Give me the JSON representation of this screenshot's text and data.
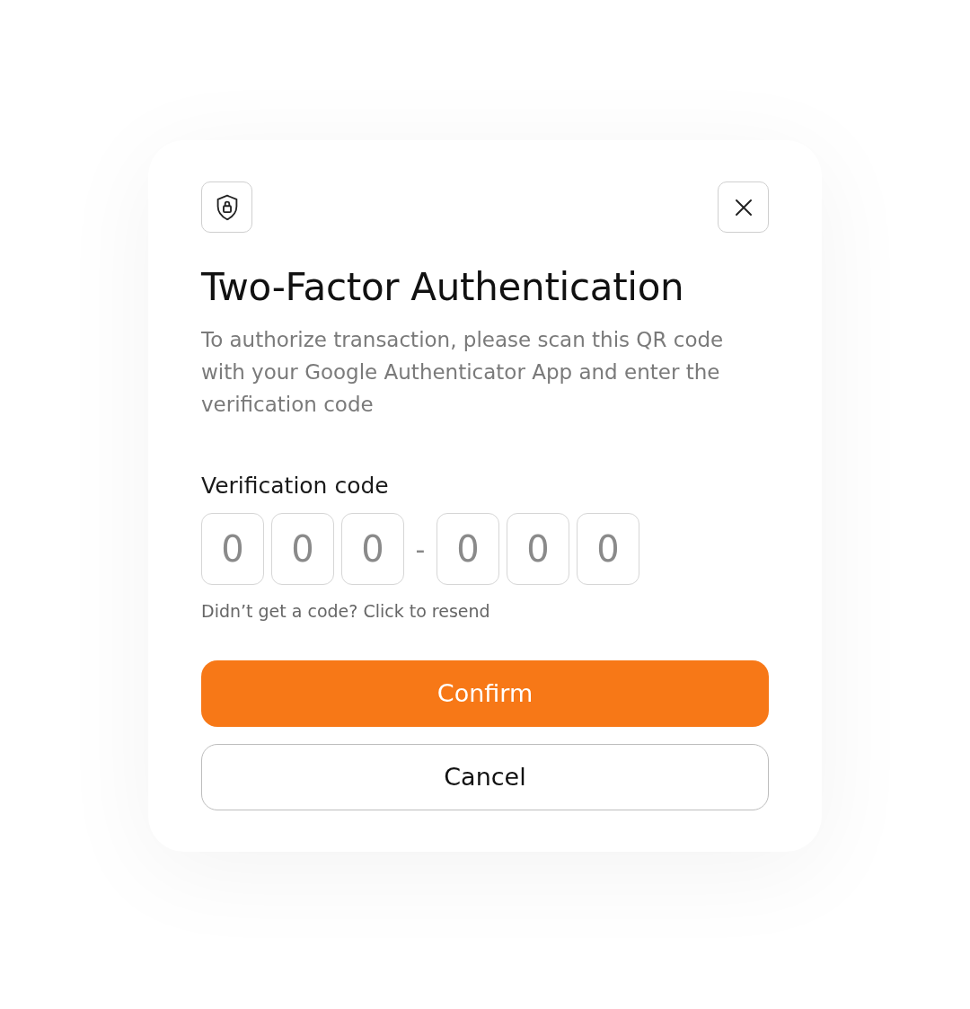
{
  "dialog": {
    "title": "Two-Factor Authentication",
    "description": "To authorize transaction, please scan this QR code with your Google Authenticator App and enter the verification code"
  },
  "code": {
    "label": "Verification code",
    "digits": [
      {
        "placeholder": "0"
      },
      {
        "placeholder": "0"
      },
      {
        "placeholder": "0"
      }
    ],
    "separator": "-",
    "digits_2": [
      {
        "placeholder": "0"
      },
      {
        "placeholder": "0"
      },
      {
        "placeholder": "0"
      }
    ]
  },
  "resend": "Didn’t get a code? Click to resend",
  "buttons": [
    {
      "label": "Confirm",
      "kind": "primary"
    },
    {
      "label": "Cancel",
      "kind": "secondary"
    }
  ]
}
